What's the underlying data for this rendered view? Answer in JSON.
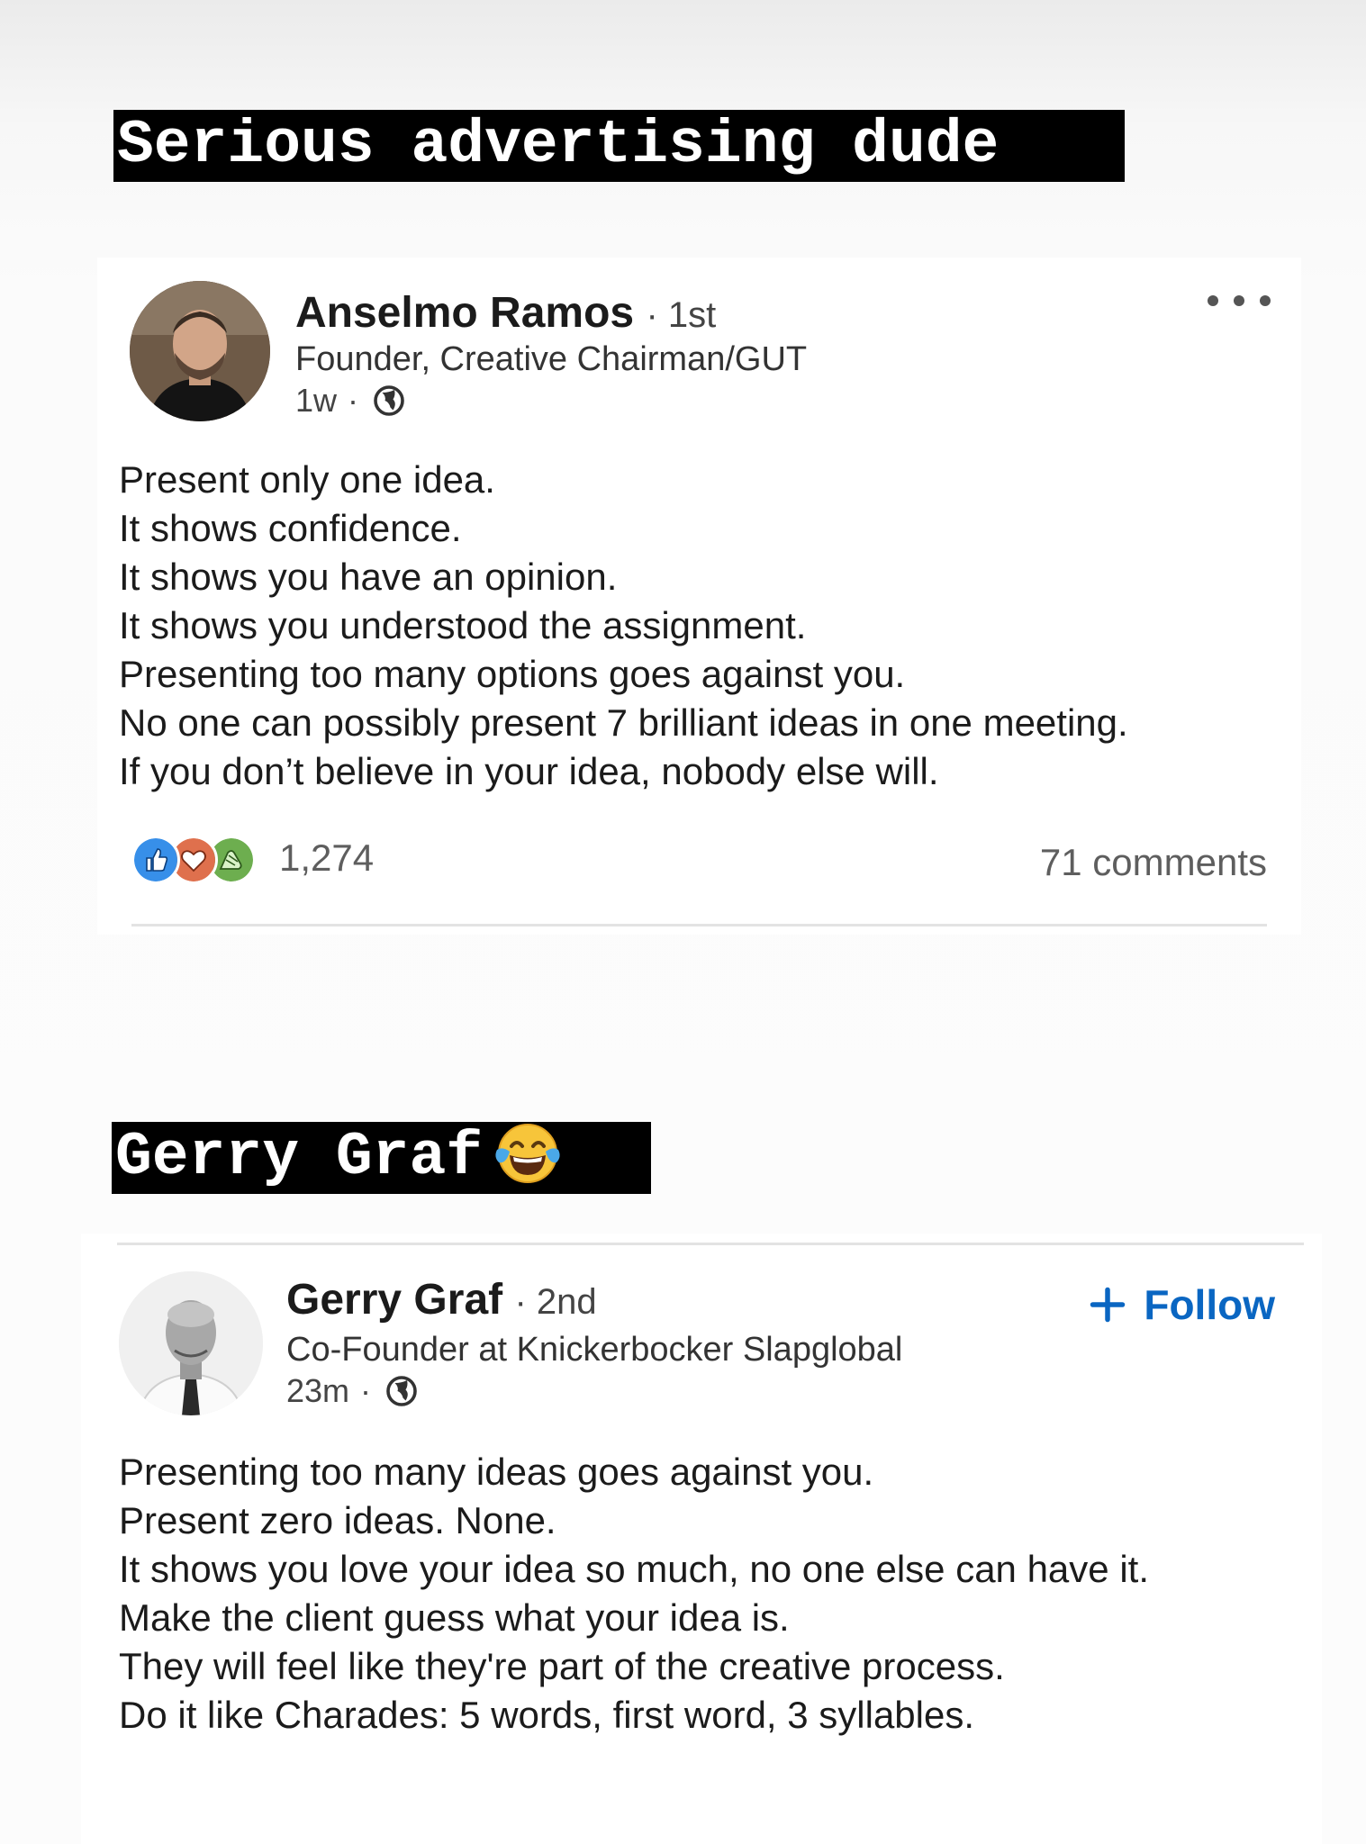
{
  "captions": {
    "first": "Serious advertising dude",
    "second": "Gerry Graf"
  },
  "emoji": {
    "icon": "face-with-tears-of-joy-icon"
  },
  "post1": {
    "author_name": "Anselmo Ramos",
    "degree": "· 1st",
    "headline": "Founder, Creative Chairman/GUT",
    "time": "1w",
    "separator": "·",
    "visibility_icon": "globe-icon",
    "body": [
      "Present only one idea.",
      "It shows confidence.",
      "It shows you have an opinion.",
      "It shows you understood the assignment.",
      "Presenting too many options goes against you.",
      "No one can possibly present 7 brilliant ideas in one meeting.",
      "If you don’t believe in your idea, nobody else will."
    ],
    "reaction_icons": [
      "like-icon",
      "love-icon",
      "celebrate-icon"
    ],
    "reaction_count": "1,274",
    "comments": "71 comments"
  },
  "post2": {
    "author_name": "Gerry Graf",
    "degree": "· 2nd",
    "headline": "Co-Founder at Knickerbocker Slapglobal",
    "time": "23m",
    "separator": "·",
    "visibility_icon": "globe-icon",
    "follow_label": "Follow",
    "body": [
      "Presenting too many ideas goes against you.",
      "Present zero ideas. None.",
      "It shows you love your idea so much, no one else can have it.",
      "Make the client guess what your idea is.",
      "They will feel like they're part of the creative process.",
      "Do it like Charades: 5 words, first word, 3 syllables."
    ]
  },
  "colors": {
    "caption_bg": "#000000",
    "caption_text": "#ffffff",
    "link_blue": "#0a66c2",
    "like_blue": "#378fe9",
    "love_red": "#df704d",
    "celebrate_green": "#44712e"
  }
}
